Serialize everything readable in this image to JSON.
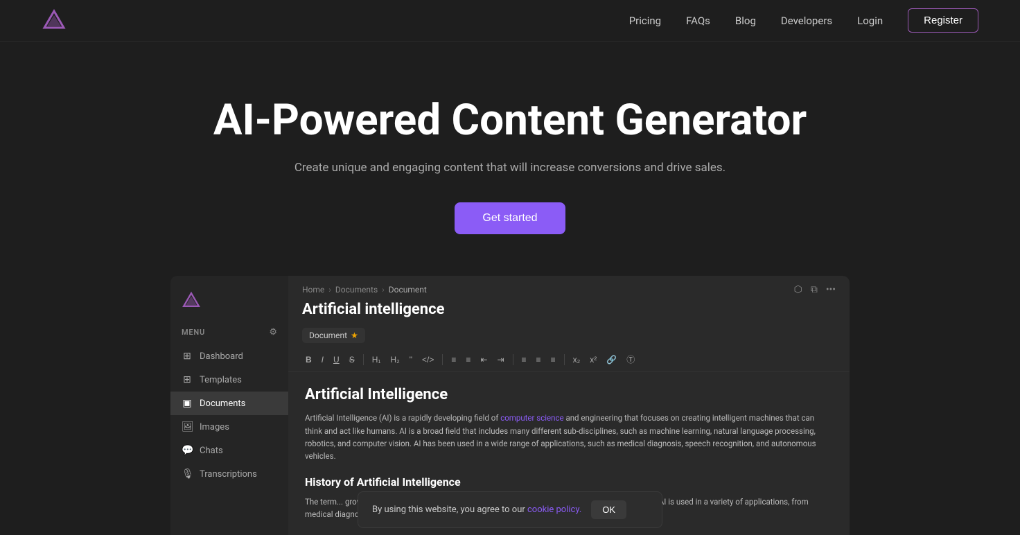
{
  "navbar": {
    "links": [
      "Pricing",
      "FAQs",
      "Blog",
      "Developers",
      "Login"
    ],
    "register_label": "Register"
  },
  "hero": {
    "title": "AI-Powered Content Generator",
    "subtitle": "Create unique and engaging content that will increase conversions and drive sales.",
    "cta_label": "Get started"
  },
  "preview": {
    "sidebar": {
      "menu_label": "MENU",
      "items": [
        {
          "label": "Dashboard",
          "icon": "⊞",
          "active": false
        },
        {
          "label": "Templates",
          "icon": "⊞",
          "active": false
        },
        {
          "label": "Documents",
          "icon": "⊟",
          "active": true
        },
        {
          "label": "Images",
          "icon": "🖼",
          "active": false
        },
        {
          "label": "Chats",
          "icon": "💬",
          "active": false
        },
        {
          "label": "Transcriptions",
          "icon": "🎙",
          "active": false
        }
      ]
    },
    "document": {
      "breadcrumb": [
        "Home",
        "Documents",
        "Document"
      ],
      "title": "Artificial intelligence",
      "tab_label": "Document",
      "content_title": "Artificial Intelligence",
      "content_body": "Artificial Intelligence (AI) is a rapidly developing field of computer science and engineering that focuses on creating intelligent machines that can think and act like humans. AI is a broad field that includes many different sub-disciplines, such as machine learning, natural language processing, robotics, and computer vision. AI has been used in a wide range of applications, such as medical diagnosis, speech recognition, and autonomous vehicles.",
      "content_link_text": "computer science",
      "content_h2": "History of Artificial Intelligence",
      "content_body2": "The term... grown rap... AI researchers focused on developing algorithms... became possible. Today, AI is used in a variety of applications, from medical diagnosis to autonomous vehicles."
    }
  },
  "cookie": {
    "text": "By using this website, you agree to our",
    "link_text": "cookie policy.",
    "ok_label": "OK"
  }
}
